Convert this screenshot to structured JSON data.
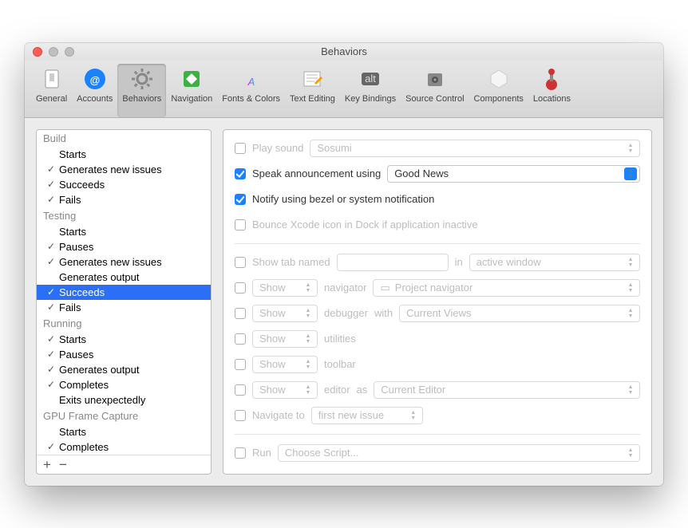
{
  "window": {
    "title": "Behaviors"
  },
  "toolbar": [
    {
      "id": "general",
      "label": "General"
    },
    {
      "id": "accounts",
      "label": "Accounts"
    },
    {
      "id": "behaviors",
      "label": "Behaviors",
      "selected": true
    },
    {
      "id": "navigation",
      "label": "Navigation"
    },
    {
      "id": "fonts",
      "label": "Fonts & Colors"
    },
    {
      "id": "text",
      "label": "Text Editing"
    },
    {
      "id": "keys",
      "label": "Key Bindings"
    },
    {
      "id": "source",
      "label": "Source Control"
    },
    {
      "id": "components",
      "label": "Components"
    },
    {
      "id": "locations",
      "label": "Locations"
    }
  ],
  "sidebar": [
    {
      "type": "group",
      "label": "Build"
    },
    {
      "type": "item",
      "label": "Starts",
      "checked": false
    },
    {
      "type": "item",
      "label": "Generates new issues",
      "checked": true
    },
    {
      "type": "item",
      "label": "Succeeds",
      "checked": true
    },
    {
      "type": "item",
      "label": "Fails",
      "checked": true
    },
    {
      "type": "group",
      "label": "Testing"
    },
    {
      "type": "item",
      "label": "Starts",
      "checked": false
    },
    {
      "type": "item",
      "label": "Pauses",
      "checked": true
    },
    {
      "type": "item",
      "label": "Generates new issues",
      "checked": true
    },
    {
      "type": "item",
      "label": "Generates output",
      "checked": false
    },
    {
      "type": "item",
      "label": "Succeeds",
      "checked": true,
      "selected": true
    },
    {
      "type": "item",
      "label": "Fails",
      "checked": true
    },
    {
      "type": "group",
      "label": "Running"
    },
    {
      "type": "item",
      "label": "Starts",
      "checked": true
    },
    {
      "type": "item",
      "label": "Pauses",
      "checked": true
    },
    {
      "type": "item",
      "label": "Generates output",
      "checked": true
    },
    {
      "type": "item",
      "label": "Completes",
      "checked": true
    },
    {
      "type": "item",
      "label": "Exits unexpectedly",
      "checked": false
    },
    {
      "type": "group",
      "label": "GPU Frame Capture"
    },
    {
      "type": "item",
      "label": "Starts",
      "checked": false
    },
    {
      "type": "item",
      "label": "Completes",
      "checked": true
    }
  ],
  "footer": {
    "add": "+",
    "remove": "−"
  },
  "pane": {
    "playSound": {
      "label": "Play sound",
      "checked": false,
      "value": "Sosumi"
    },
    "speak": {
      "label": "Speak announcement using",
      "checked": true,
      "value": "Good News"
    },
    "notify": {
      "label": "Notify using bezel or system notification",
      "checked": true
    },
    "bounce": {
      "label": "Bounce Xcode icon in Dock if application inactive",
      "checked": false
    },
    "showTab": {
      "label": "Show tab named",
      "checked": false,
      "midword": "in",
      "value": "active window"
    },
    "navigator": {
      "checked": false,
      "action": "Show",
      "label": "navigator",
      "value": "Project navigator"
    },
    "debugger": {
      "checked": false,
      "action": "Show",
      "label": "debugger",
      "mid": "with",
      "value": "Current Views"
    },
    "utilities": {
      "checked": false,
      "action": "Show",
      "label": "utilities"
    },
    "toolbarRow": {
      "checked": false,
      "action": "Show",
      "label": "toolbar"
    },
    "editor": {
      "checked": false,
      "action": "Show",
      "label": "editor",
      "mid": "as",
      "value": "Current Editor"
    },
    "navigate": {
      "checked": false,
      "label": "Navigate to",
      "value": "first new issue"
    },
    "run": {
      "checked": false,
      "label": "Run",
      "value": "Choose Script..."
    }
  }
}
